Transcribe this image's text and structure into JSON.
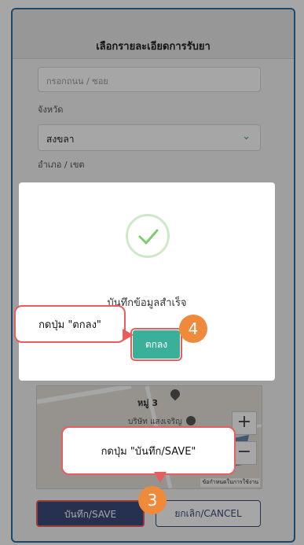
{
  "header": {
    "title": "เลือกรายละเอียดการรับยา"
  },
  "form": {
    "street_placeholder": "กรอกถนน / ซอย",
    "province_label": "จังหวัด",
    "province_value": "สงขลา",
    "district_label": "อำเภอ / เขต"
  },
  "map": {
    "place_1": "หมู่ 3",
    "place_2": "บริษัท แสงเจริญ",
    "zoom_in": "+",
    "zoom_out": "−",
    "terms": "ข้อกำหนดในการใช้งาน"
  },
  "bottom": {
    "save_label": "บันทึก/SAVE",
    "cancel_label": "ยกเลิก/CANCEL"
  },
  "modal": {
    "message": "บันทึกข้อมูลสำเร็จ",
    "ok_label": "ตกลง"
  },
  "annotations": {
    "callout_ok": "กดปุ่ม \"ตกลง\"",
    "callout_save": "กดปุ่ม \"บันทึก/SAVE\"",
    "step_4": "4",
    "step_3": "3"
  },
  "colors": {
    "accent": "#3ab09a",
    "primary": "#3a4c7a",
    "highlight": "#e85d5d",
    "badge": "#ee8a3a"
  }
}
